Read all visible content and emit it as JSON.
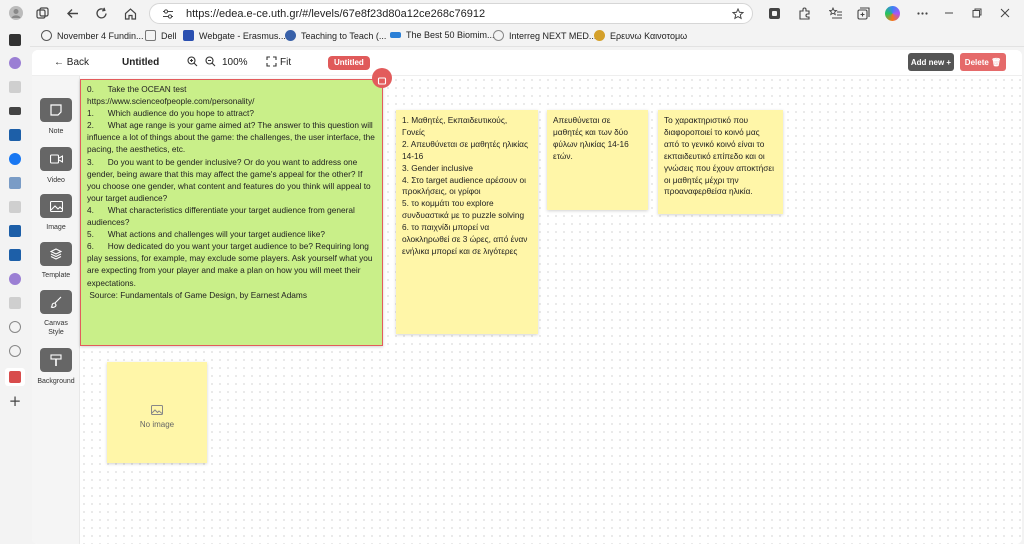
{
  "browser": {
    "url": "https://edea.e-ce.uth.gr/#/levels/67e8f23d80a12ce268c76912",
    "bookmarks": [
      {
        "label": "November 4 Fundin...",
        "color": "#555555"
      },
      {
        "label": "Dell",
        "color": "#777777"
      },
      {
        "label": "Webgate - Erasmus...",
        "color": "#2a4fb0"
      },
      {
        "label": "Teaching to Teach (...",
        "color": "#3860a8"
      },
      {
        "label": "The Best 50 Biomim...",
        "color": "#2a7fd6"
      },
      {
        "label": "Interreg NEXT MED...",
        "color": "#888888"
      },
      {
        "label": "Ερευνω Καινοτομω",
        "color": "#d4a02a"
      }
    ]
  },
  "toolbar": {
    "back_label": "← Back",
    "title": "Untitled",
    "zoom": "100%",
    "fit_label": "Fit",
    "title_badge": "Untitled",
    "add_label": "Add new +",
    "delete_label": "Delete 🗑"
  },
  "tools": [
    {
      "label": "Note",
      "icon": "note-icon"
    },
    {
      "label": "Video",
      "icon": "video-icon"
    },
    {
      "label": "Image",
      "icon": "image-icon"
    },
    {
      "label": "Template",
      "icon": "template-icon"
    },
    {
      "label": "Canvas Style",
      "icon": "brush-icon"
    },
    {
      "label": "Background",
      "icon": "paint-roller-icon"
    }
  ],
  "notes": {
    "green": "0.      Take the OCEAN test\nhttps://www.scienceofpeople.com/personality/\n1.      Which audience do you hope to attract?\n2.      What age range is your game aimed at? The answer to this question will influence a lot of things about the game: the challenges, the user interface, the pacing, the aesthetics, etc.\n3.      Do you want to be gender inclusive? Or do you want to address one gender, being aware that this may affect the game's appeal for the other? If you choose one gender, what content and features do you think will appeal to your target audience?\n4.      What characteristics differentiate your target audience from general audiences?\n5.      What actions and challenges will your target audience like?\n6.      How dedicated do you want your target audience to be? Requiring long play sessions, for example, may exclude some players. Ask yourself what you are expecting from your player and make a plan on how you will meet their expectations.\n Source: Fundamentals of Game Design, by Earnest Adams",
    "note2": "1. Μαθητές, Εκπαιδευτικούς, Γονείς\n2. Απευθύνεται σε μαθητές ηλικίας 14-16\n3. Gender inclusive\n4. Στο target audience αρέσουν οι προκλήσεις, οι γρίφοι\n5. το κομμάτι του explore συνδυαστικά με το puzzle solving\n6. το παιχνίδι μπορεί να ολοκληρωθεί σε 3 ώρες, από έναν ενήλικα μπορεί και σε λιγότερες",
    "note3": "Απευθύνεται σε μαθητές και των δύο φύλων ηλικίας 14-16 ετών.",
    "note4": "Το χαρακτηριστικό που διαφοροποιεί το κοινό μας από το γενικό κοινό είναι το εκπαιδευτικό επίπεδο και οι γνώσεις που έχουν αποκτήσει οι μαθητές μέχρι την προαναφερθείσα ηλικία."
  },
  "image_card": {
    "label": "No image"
  }
}
